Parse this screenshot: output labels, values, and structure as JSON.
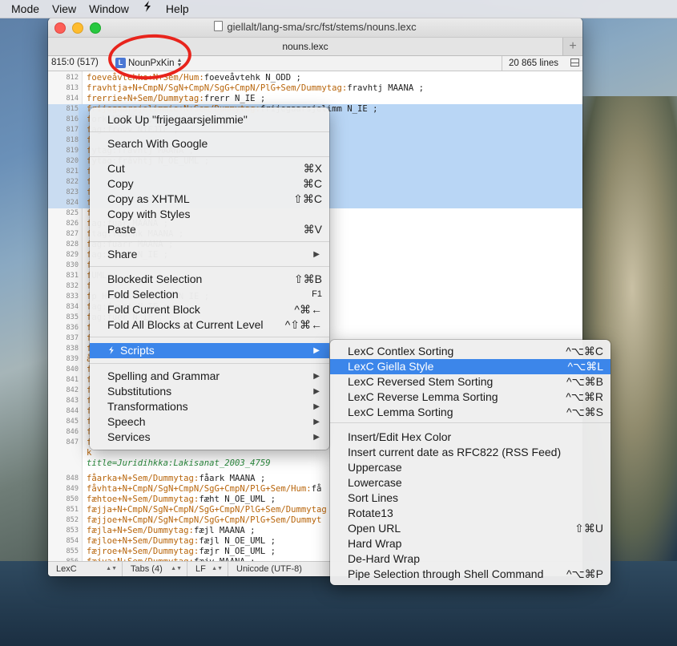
{
  "menubar": {
    "items": [
      "Mode",
      "View",
      "Window",
      "S",
      "Help"
    ]
  },
  "window": {
    "title": "giellalt/lang-sma/src/fst/stems/nouns.lexc",
    "tab": "nouns.lexc",
    "nav_position": "815:0 (517)",
    "nav_block": "NounPxKin",
    "nav_block_badge": "L",
    "line_count": "20 865 lines"
  },
  "editor_lines": [
    {
      "n": "812",
      "pre": "foeveåvtehke+N+Sem/Hum:",
      "post": "foeveåvtehk N_ODD ;",
      "sel": false
    },
    {
      "n": "813",
      "pre": "fravhtja+N+CmpN/SgN+CmpN/SgG+CmpN/PlG+Sem/Dummytag:",
      "post": "fravhtj MAANA ;",
      "sel": false
    },
    {
      "n": "814",
      "pre": "frerrie+N+Sem/Dummytag:",
      "post": "frerr N_IE ;",
      "sel": false
    },
    {
      "n": "815",
      "pre": "frijegaarsjelimmie+N+Sem/Dummytag:",
      "post": "frijegaarsjelimm N_IE ;",
      "sel": true
    },
    {
      "n": "816",
      "pre": "f",
      "post": "ork NIEJTE ;",
      "sel": true
    },
    {
      "n": "817",
      "pre": "f",
      "post": "ag:frovv NIEJTE ;",
      "sel": true
    },
    {
      "n": "818",
      "pre": "f",
      "post": "",
      "sel": true
    },
    {
      "n": "819",
      "pre": "f",
      "post": "ytag:fråvhtj MAANA ;",
      "sel": true
    },
    {
      "n": "820",
      "pre": "f",
      "post": "ytag:fråvhtj N_OE_UML ;",
      "sel": true
    },
    {
      "n": "821",
      "pre": "f",
      "post": "",
      "sel": true
    },
    {
      "n": "822",
      "pre": "f",
      "post": "",
      "sel": true
    },
    {
      "n": "823",
      "pre": "f",
      "post": "",
      "sel": true
    },
    {
      "n": "824",
      "pre": "f",
      "post": "",
      "sel": true
    },
    {
      "n": "825",
      "pre": "f",
      "post": "",
      "sel": false
    },
    {
      "n": "826",
      "pre": "f",
      "post": "ag:fuar MAANA ;",
      "sel": false
    },
    {
      "n": "827",
      "pre": "f",
      "post": "tag:fuarhk MAANA ;",
      "sel": false
    },
    {
      "n": "828",
      "pre": "f",
      "post": "ag:fuarr MAANA ;",
      "sel": false
    },
    {
      "n": "829",
      "pre": "f",
      "post": "ag:fuebt N_IE ;",
      "sel": false
    },
    {
      "n": "830",
      "pre": "f",
      "post": "",
      "sel": false
    },
    {
      "n": "831",
      "pre": "f",
      "post": "UML ;",
      "sel": false
    },
    {
      "n": "832",
      "pre": "f",
      "post": "",
      "sel": false
    },
    {
      "n": "833",
      "pre": "f",
      "post": "p_Hum_Plc:fuelhk N_IE ;",
      "sel": false
    },
    {
      "n": "834",
      "pre": "f",
      "post": "ag:fuemt N_IE ;",
      "sel": false
    },
    {
      "n": "835",
      "pre": "f",
      "post": "ag:fuer N_IE ;",
      "sel": false
    },
    {
      "n": "836",
      "pre": "f",
      "post": "",
      "sel": false
    },
    {
      "n": "837",
      "pre": "f",
      "post": "",
      "sel": false
    },
    {
      "n": "838",
      "pre": "f",
      "post": "",
      "sel": false
    },
    {
      "n": "839",
      "pre": "å",
      "post": "",
      "sel": false
    },
    {
      "n": "840",
      "pre": "f",
      "post": "",
      "sel": false
    },
    {
      "n": "841",
      "pre": "f",
      "post": "",
      "sel": false
    },
    {
      "n": "842",
      "pre": "f",
      "post": "",
      "sel": false
    },
    {
      "n": "843",
      "pre": "f",
      "post": "",
      "sel": false
    },
    {
      "n": "844",
      "pre": "f",
      "post": "",
      "sel": false
    },
    {
      "n": "845",
      "pre": "f",
      "post": "",
      "sel": false
    },
    {
      "n": "846",
      "pre": "f",
      "post": "",
      "sel": false
    },
    {
      "n": "847",
      "pre": "f",
      "post": "",
      "sel": false
    },
    {
      "n": "",
      "pre": "k",
      "post": "",
      "sel": false
    },
    {
      "n": "",
      "pre": "",
      "post": "",
      "sel": false,
      "comment": "title=Juridihkka:Lakisanat_2003_4759"
    },
    {
      "n": "848",
      "pre": "fåarka+N+Sem/Dummytag:",
      "post": "fåark MAANA ;",
      "sel": false
    },
    {
      "n": "849",
      "pre": "fåvhta+N+CmpN/SgN+CmpN/SgG+CmpN/PlG+Sem/Hum:",
      "post": "få",
      "sel": false
    },
    {
      "n": "850",
      "pre": "fæhtoe+N+Sem/Dummytag:",
      "post": "fæht N_OE_UML ;",
      "sel": false
    },
    {
      "n": "851",
      "pre": "fæjja+N+CmpN/SgN+CmpN/SgG+CmpN/PlG+Sem/Dummytag",
      "post": "",
      "sel": false
    },
    {
      "n": "852",
      "pre": "fæjjoe+N+CmpN/SgN+CmpN/SgG+CmpN/PlG+Sem/Dummyt",
      "post": "",
      "sel": false
    },
    {
      "n": "853",
      "pre": "fæjla+N+Sem/Dummytag:",
      "post": "fæjl MAANA ;",
      "sel": false
    },
    {
      "n": "854",
      "pre": "fæjloe+N+Sem/Dummytag:",
      "post": "fæjl N_OE_UML ;",
      "sel": false
    },
    {
      "n": "855",
      "pre": "fæjroe+N+Sem/Dummytag:",
      "post": "fæjr N_OE_UML ;",
      "sel": false
    },
    {
      "n": "856",
      "pre": "fæjva+N+Sem/Dummytag:",
      "post": "fæjv MAANA ;",
      "sel": false
    },
    {
      "n": "857",
      "pre": "fænta+N+CmpN/SgN+CmpN/SgG+CmpN/PlG+Sem/Dummyta",
      "post": "",
      "sel": false
    }
  ],
  "statusbar": {
    "syntax": "LexC",
    "tabs": "Tabs (4)",
    "line_ending": "LF",
    "encoding": "Unicode (UTF-8)"
  },
  "context_menu": {
    "look_up": "Look Up \"frijegaarsjelimmie\"",
    "search_google": "Search With Google",
    "cut": "Cut",
    "cut_sc": "⌘X",
    "copy": "Copy",
    "copy_sc": "⌘C",
    "copy_xhtml": "Copy as XHTML",
    "copy_xhtml_sc": "⇧⌘C",
    "copy_styles": "Copy with Styles",
    "paste": "Paste",
    "paste_sc": "⌘V",
    "share": "Share",
    "blockedit": "Blockedit Selection",
    "blockedit_sc": "⇧⌘B",
    "fold_selection": "Fold Selection",
    "fold_selection_sc": "F1",
    "fold_block": "Fold Current Block",
    "fold_block_sc": "^⌘←",
    "fold_all": "Fold All Blocks at Current Level",
    "fold_all_sc": "^⇧⌘←",
    "scripts": "Scripts",
    "spelling": "Spelling and Grammar",
    "substitutions": "Substitutions",
    "transformations": "Transformations",
    "speech": "Speech",
    "services": "Services"
  },
  "scripts_menu": {
    "items": [
      {
        "label": "LexC Contlex Sorting",
        "sc": "^⌥⌘C"
      },
      {
        "label": "LexC Giella Style",
        "sc": "^⌥⌘L"
      },
      {
        "label": "LexC Reversed Stem Sorting",
        "sc": "^⌥⌘B"
      },
      {
        "label": "LexC Reverse Lemma Sorting",
        "sc": "^⌥⌘R"
      },
      {
        "label": "LexC Lemma Sorting",
        "sc": "^⌥⌘S"
      },
      {
        "label": "Insert/Edit Hex Color",
        "sc": ""
      },
      {
        "label": "Insert current date as RFC822 (RSS Feed)",
        "sc": ""
      },
      {
        "label": "Uppercase",
        "sc": ""
      },
      {
        "label": "Lowercase",
        "sc": ""
      },
      {
        "label": "Sort Lines",
        "sc": ""
      },
      {
        "label": "Rotate13",
        "sc": ""
      },
      {
        "label": "Open URL",
        "sc": "⇧⌘U"
      },
      {
        "label": "Hard Wrap",
        "sc": ""
      },
      {
        "label": "De-Hard Wrap",
        "sc": ""
      },
      {
        "label": "Pipe Selection through Shell Command",
        "sc": "^⌥⌘P"
      }
    ]
  },
  "colors": {
    "accent": "#3c86ea",
    "selection": "#b9d6f5",
    "annotation": "#e8241c",
    "code_value": "#b8650b"
  }
}
